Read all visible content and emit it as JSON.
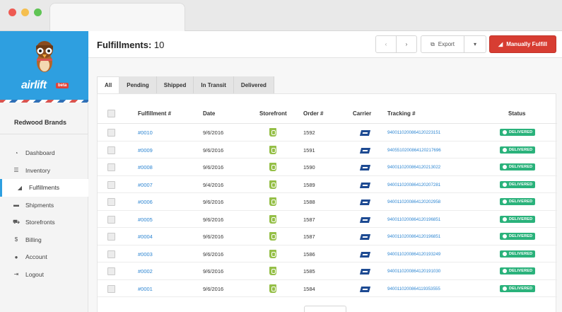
{
  "sidebar": {
    "logo_text": "airlift",
    "beta_label": "beta",
    "org_name": "Redwood Brands",
    "items": [
      {
        "label": "Dashboard",
        "icon": "dashboard-icon",
        "glyph": "◔"
      },
      {
        "label": "Inventory",
        "icon": "list-icon",
        "glyph": "☰"
      },
      {
        "label": "Fulfillments",
        "icon": "send-icon",
        "glyph": "◢"
      },
      {
        "label": "Shipments",
        "icon": "truck-icon",
        "glyph": "▬"
      },
      {
        "label": "Storefronts",
        "icon": "cart-icon",
        "glyph": "⛟"
      },
      {
        "label": "Billing",
        "icon": "dollar-icon",
        "glyph": "$"
      },
      {
        "label": "Account",
        "icon": "user-icon",
        "glyph": "●"
      },
      {
        "label": "Logout",
        "icon": "logout-icon",
        "glyph": "⇥"
      }
    ],
    "active_index": 2
  },
  "header": {
    "title_label": "Fulfillments:",
    "title_count": "10",
    "prev_glyph": "‹",
    "next_glyph": "›",
    "export_label": "Export",
    "caret_glyph": "▾",
    "fulfill_label": "Manually Fulfill"
  },
  "tabs": [
    "All",
    "Pending",
    "Shipped",
    "In Transit",
    "Delivered"
  ],
  "table": {
    "columns": {
      "fulfillment": "Fulfillment #",
      "date": "Date",
      "storefront": "Storefront",
      "order": "Order #",
      "carrier": "Carrier",
      "tracking": "Tracking #",
      "status": "Status"
    },
    "rows": [
      {
        "fulfillment": "#0010",
        "date": "9/6/2016",
        "order": "1592",
        "tracking": "9400110200864120223151",
        "status": "DELIVERED"
      },
      {
        "fulfillment": "#0009",
        "date": "9/6/2016",
        "order": "1591",
        "tracking": "9405510200864120217696",
        "status": "DELIVERED"
      },
      {
        "fulfillment": "#0008",
        "date": "9/6/2016",
        "order": "1590",
        "tracking": "9400110200864120213022",
        "status": "DELIVERED"
      },
      {
        "fulfillment": "#0007",
        "date": "9/4/2016",
        "order": "1589",
        "tracking": "9400110200864120207281",
        "status": "DELIVERED"
      },
      {
        "fulfillment": "#0006",
        "date": "9/6/2016",
        "order": "1588",
        "tracking": "9400110200864120202958",
        "status": "DELIVERED"
      },
      {
        "fulfillment": "#0005",
        "date": "9/6/2016",
        "order": "1587",
        "tracking": "9400110200864120196851",
        "status": "DELIVERED"
      },
      {
        "fulfillment": "#0004",
        "date": "9/6/2016",
        "order": "1587",
        "tracking": "9400110200864120196851",
        "status": "DELIVERED"
      },
      {
        "fulfillment": "#0003",
        "date": "9/6/2016",
        "order": "1586",
        "tracking": "9400110200864120193249",
        "status": "DELIVERED"
      },
      {
        "fulfillment": "#0002",
        "date": "9/6/2016",
        "order": "1585",
        "tracking": "9400110200864120191030",
        "status": "DELIVERED"
      },
      {
        "fulfillment": "#0001",
        "date": "9/6/2016",
        "order": "1584",
        "tracking": "9400110200864119353555",
        "status": "DELIVERED"
      }
    ]
  },
  "colors": {
    "brand_blue": "#2e9fe0",
    "fulfill_red": "#d73d32",
    "delivered_green": "#2ab27b",
    "link_blue": "#2e86d2"
  }
}
